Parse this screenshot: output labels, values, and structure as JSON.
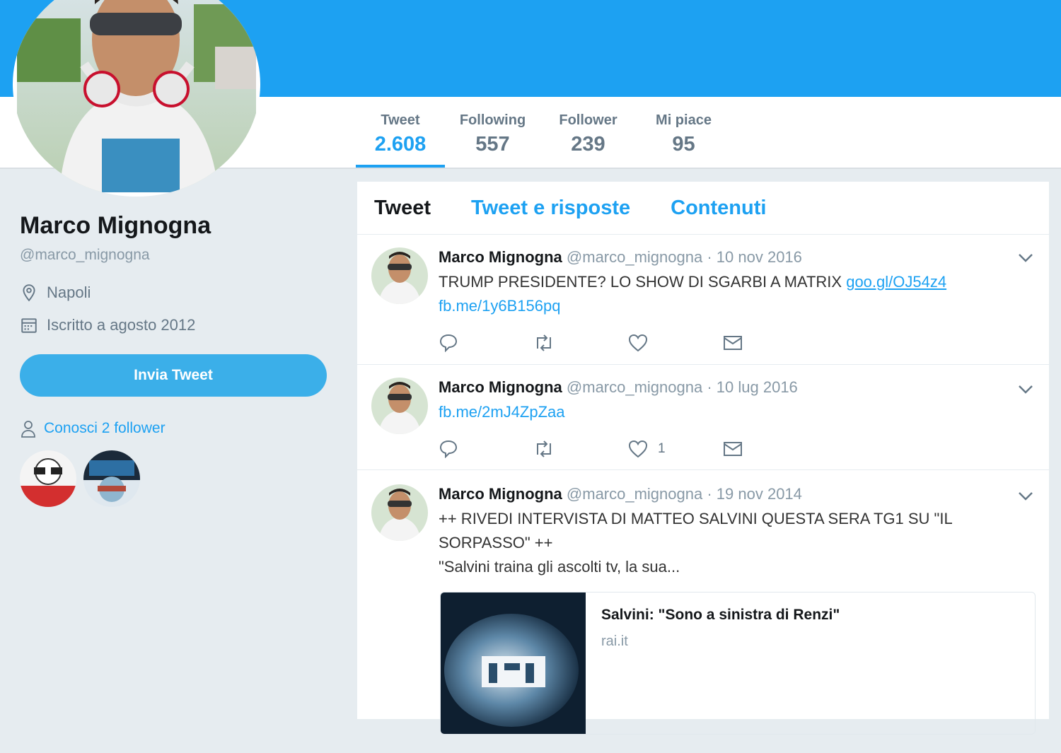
{
  "profile": {
    "name": "Marco Mignogna",
    "handle": "@marco_mignogna",
    "location": "Napoli",
    "joined": "Iscritto a agosto 2012",
    "tweet_button": "Invia Tweet",
    "followers_you_know": "Conosci 2 follower"
  },
  "stats": [
    {
      "label": "Tweet",
      "value": "2.608"
    },
    {
      "label": "Following",
      "value": "557"
    },
    {
      "label": "Follower",
      "value": "239"
    },
    {
      "label": "Mi piace",
      "value": "95"
    }
  ],
  "tabs": [
    "Tweet",
    "Tweet e risposte",
    "Contenuti"
  ],
  "tweets": [
    {
      "name": "Marco Mignogna",
      "handle": "@marco_mignogna",
      "date": "· 10 nov 2016",
      "text": "TRUMP PRESIDENTE? LO SHOW DI SGARBI A MATRIX",
      "link1": "goo.gl/OJ54z4",
      "link2": "fb.me/1y6B156pq",
      "likes": ""
    },
    {
      "name": "Marco Mignogna",
      "handle": "@marco_mignogna",
      "date": "· 10 lug 2016",
      "link2": "fb.me/2mJ4ZpZaa",
      "likes": "1"
    },
    {
      "name": "Marco Mignogna",
      "handle": "@marco_mignogna",
      "date": "· 19 nov 2014",
      "text_line1": "++ RIVEDI INTERVISTA DI MATTEO SALVINI QUESTA SERA TG1 SU \"IL",
      "text_line2": "SORPASSO\" ++",
      "text_line3": "\"Salvini traina gli ascolti tv, la sua...",
      "card_title": "Salvini: \"Sono a sinistra di Renzi\"",
      "card_domain": "rai.it"
    }
  ],
  "colors": {
    "accent": "#1da1f2",
    "background": "#e6ecf0",
    "banner": "#1da1f2"
  }
}
